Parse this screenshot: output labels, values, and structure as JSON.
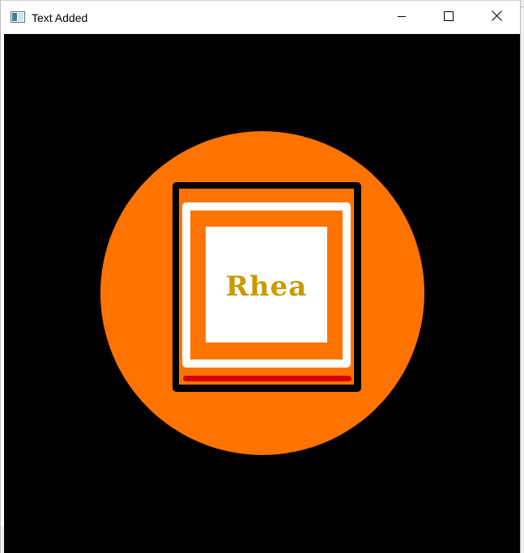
{
  "window": {
    "title": "Text Added",
    "icons": {
      "app": "app-window-icon",
      "minimize": "minimize-icon",
      "maximize": "maximize-icon",
      "close": "close-icon"
    }
  },
  "canvas": {
    "text": "Rhea",
    "colors": {
      "background": "#000000",
      "circle": "#ff7300",
      "card_border": "#000000",
      "frame": "#ffffff",
      "text": "#c99a00",
      "bar": "#d40000"
    }
  }
}
